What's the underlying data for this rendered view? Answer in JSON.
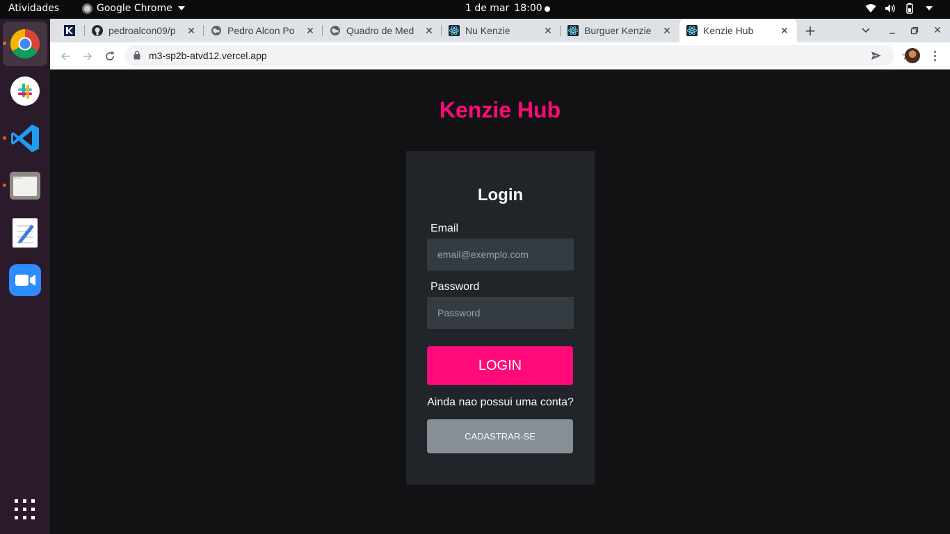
{
  "topbar": {
    "activities": "Atividades",
    "app_name": "Google Chrome",
    "date": "1 de mar",
    "time": "18:00"
  },
  "dock": {
    "apps": [
      "chrome",
      "slack",
      "vscode",
      "files",
      "text-editor",
      "zoom",
      "show-apps"
    ]
  },
  "browser": {
    "tabs": [
      {
        "title": "",
        "icon": "kenzie-icon"
      },
      {
        "title": "pedroalcon09/p",
        "icon": "github-icon"
      },
      {
        "title": "Pedro Alcon Po",
        "icon": "globe-icon"
      },
      {
        "title": "Quadro de Med",
        "icon": "globe-icon"
      },
      {
        "title": "Nu Kenzie",
        "icon": "react-icon"
      },
      {
        "title": "Burguer Kenzie",
        "icon": "react-icon"
      },
      {
        "title": "Kenzie Hub",
        "icon": "react-icon",
        "active": true
      }
    ],
    "new_tab": "+",
    "url": "m3-sp2b-atvd12.vercel.app"
  },
  "page": {
    "brand": "Kenzie Hub",
    "form": {
      "heading": "Login",
      "email_label": "Email",
      "email_placeholder": "email@exemplo.com",
      "password_label": "Password",
      "password_placeholder": "Password",
      "login_button": "LOGIN",
      "no_account_text": "Ainda nao possui uma conta?",
      "signup_button": "CADASTRAR-SE"
    }
  },
  "colors": {
    "brand_pink": "#ff0a78",
    "page_bg": "#121214",
    "card_bg": "#212529",
    "input_bg": "#343b41",
    "secondary_button": "#868e96"
  }
}
